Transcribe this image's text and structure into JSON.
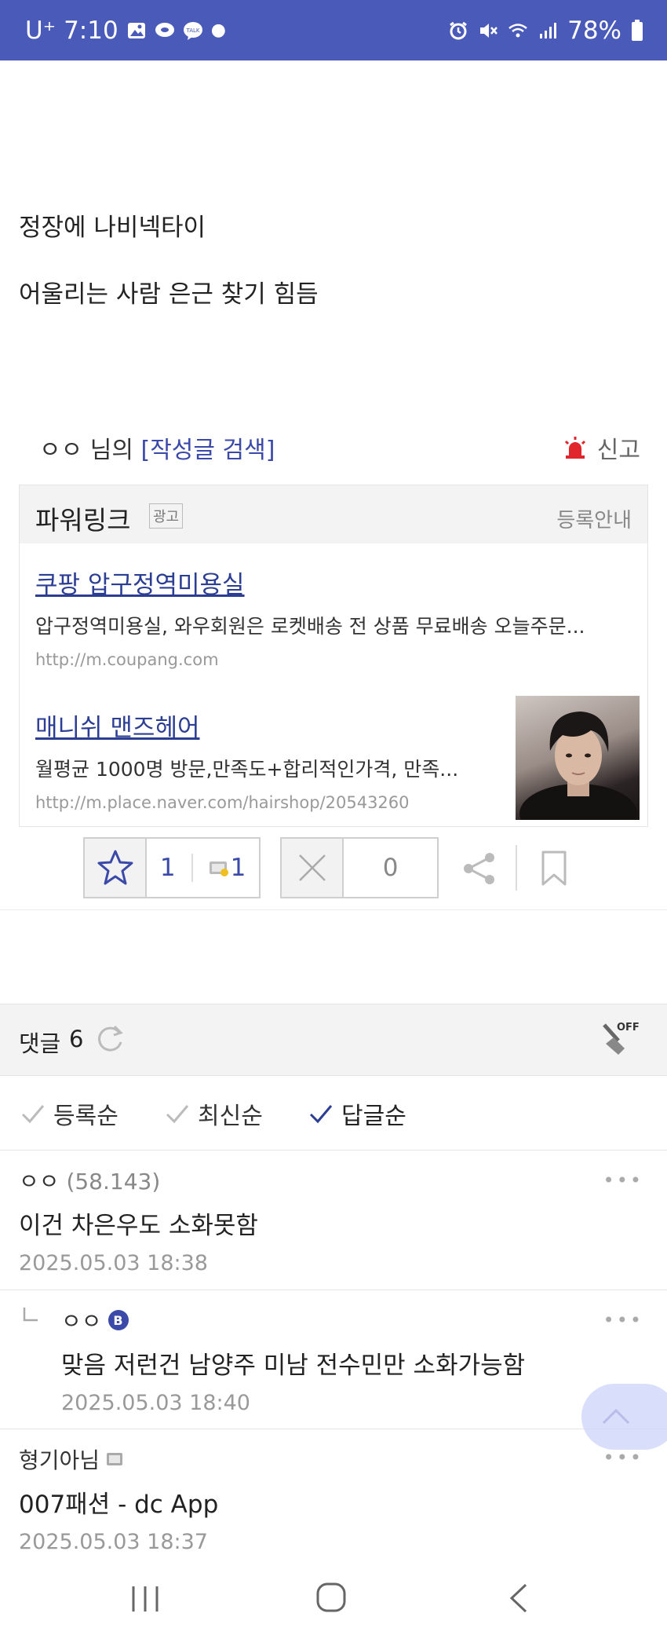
{
  "status_bar": {
    "carrier": "U⁺",
    "time": "7:10",
    "battery": "78%",
    "left_icons": [
      "gallery-icon",
      "chat-bubble-icon",
      "talk-icon"
    ],
    "right_icons": [
      "alarm-icon",
      "mute-icon",
      "wifi-icon",
      "signal-icon",
      "battery-icon"
    ]
  },
  "post": {
    "lines": [
      "정장에 나비넥타이",
      "어울리는 사람 은근 찾기 힘듬"
    ]
  },
  "author_bar": {
    "author": "ㅇㅇ",
    "suffix": "님의",
    "search_link": "[작성글 검색]",
    "report_label": "신고"
  },
  "ad": {
    "title": "파워링크",
    "tag": "광고",
    "info_link": "등록안내",
    "items": [
      {
        "title": "쿠팡 압구정역미용실",
        "desc": "압구정역미용실, 와우회원은 로켓배송 전 상품 무료배송 오늘주문...",
        "url": "http://m.coupang.com"
      },
      {
        "title": "매니쉬 맨즈헤어",
        "desc": "월평균 1000명 방문,만족도+합리적인가격, 만족...",
        "url": "http://m.place.naver.com/hairshop/20543260"
      }
    ]
  },
  "votes": {
    "up_count": "1",
    "fixed_count": "1",
    "down_count": "0"
  },
  "comments_header": {
    "label": "댓글",
    "count": "6",
    "image_toggle": "OFF"
  },
  "sort_options": [
    {
      "label": "등록순",
      "active": false
    },
    {
      "label": "최신순",
      "active": false
    },
    {
      "label": "답글순",
      "active": true
    }
  ],
  "comments": [
    {
      "name": "ㅇㅇ",
      "score": "(58.143)",
      "text": "이건 차은우도 소화못함",
      "date": "2025.05.03 18:38"
    },
    {
      "name": "ㅇㅇ",
      "badge": "B",
      "text": "맞음 저런건 남양주 미남 전수민만 소화가능함",
      "date": "2025.05.03 18:40"
    },
    {
      "name": "형기아님",
      "text": "007패션 - dc App",
      "date": "2025.05.03 18:37"
    }
  ],
  "colors": {
    "status_bar": "#4a5ab8",
    "link": "#2c3d94",
    "report_icon": "#e0262c",
    "scroll_top": "#dde1fb"
  }
}
